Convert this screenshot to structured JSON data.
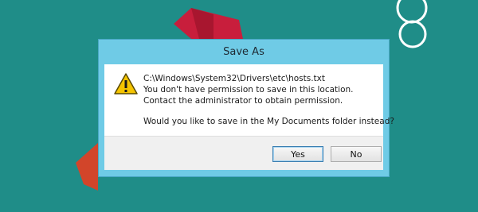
{
  "dialog": {
    "title": "Save As",
    "message_lines": [
      "C:\\Windows\\System32\\Drivers\\etc\\hosts.txt",
      "You don't have permission to save in this location.",
      "Contact the administrator to obtain permission."
    ],
    "question": "Would you like to save in the My Documents folder instead?",
    "yes_label": "Yes",
    "no_label": "No"
  },
  "colors": {
    "desktop_bg": "#1f8d88",
    "dialog_frame": "#6fcbe6",
    "accent_red": "#c81e3c"
  }
}
